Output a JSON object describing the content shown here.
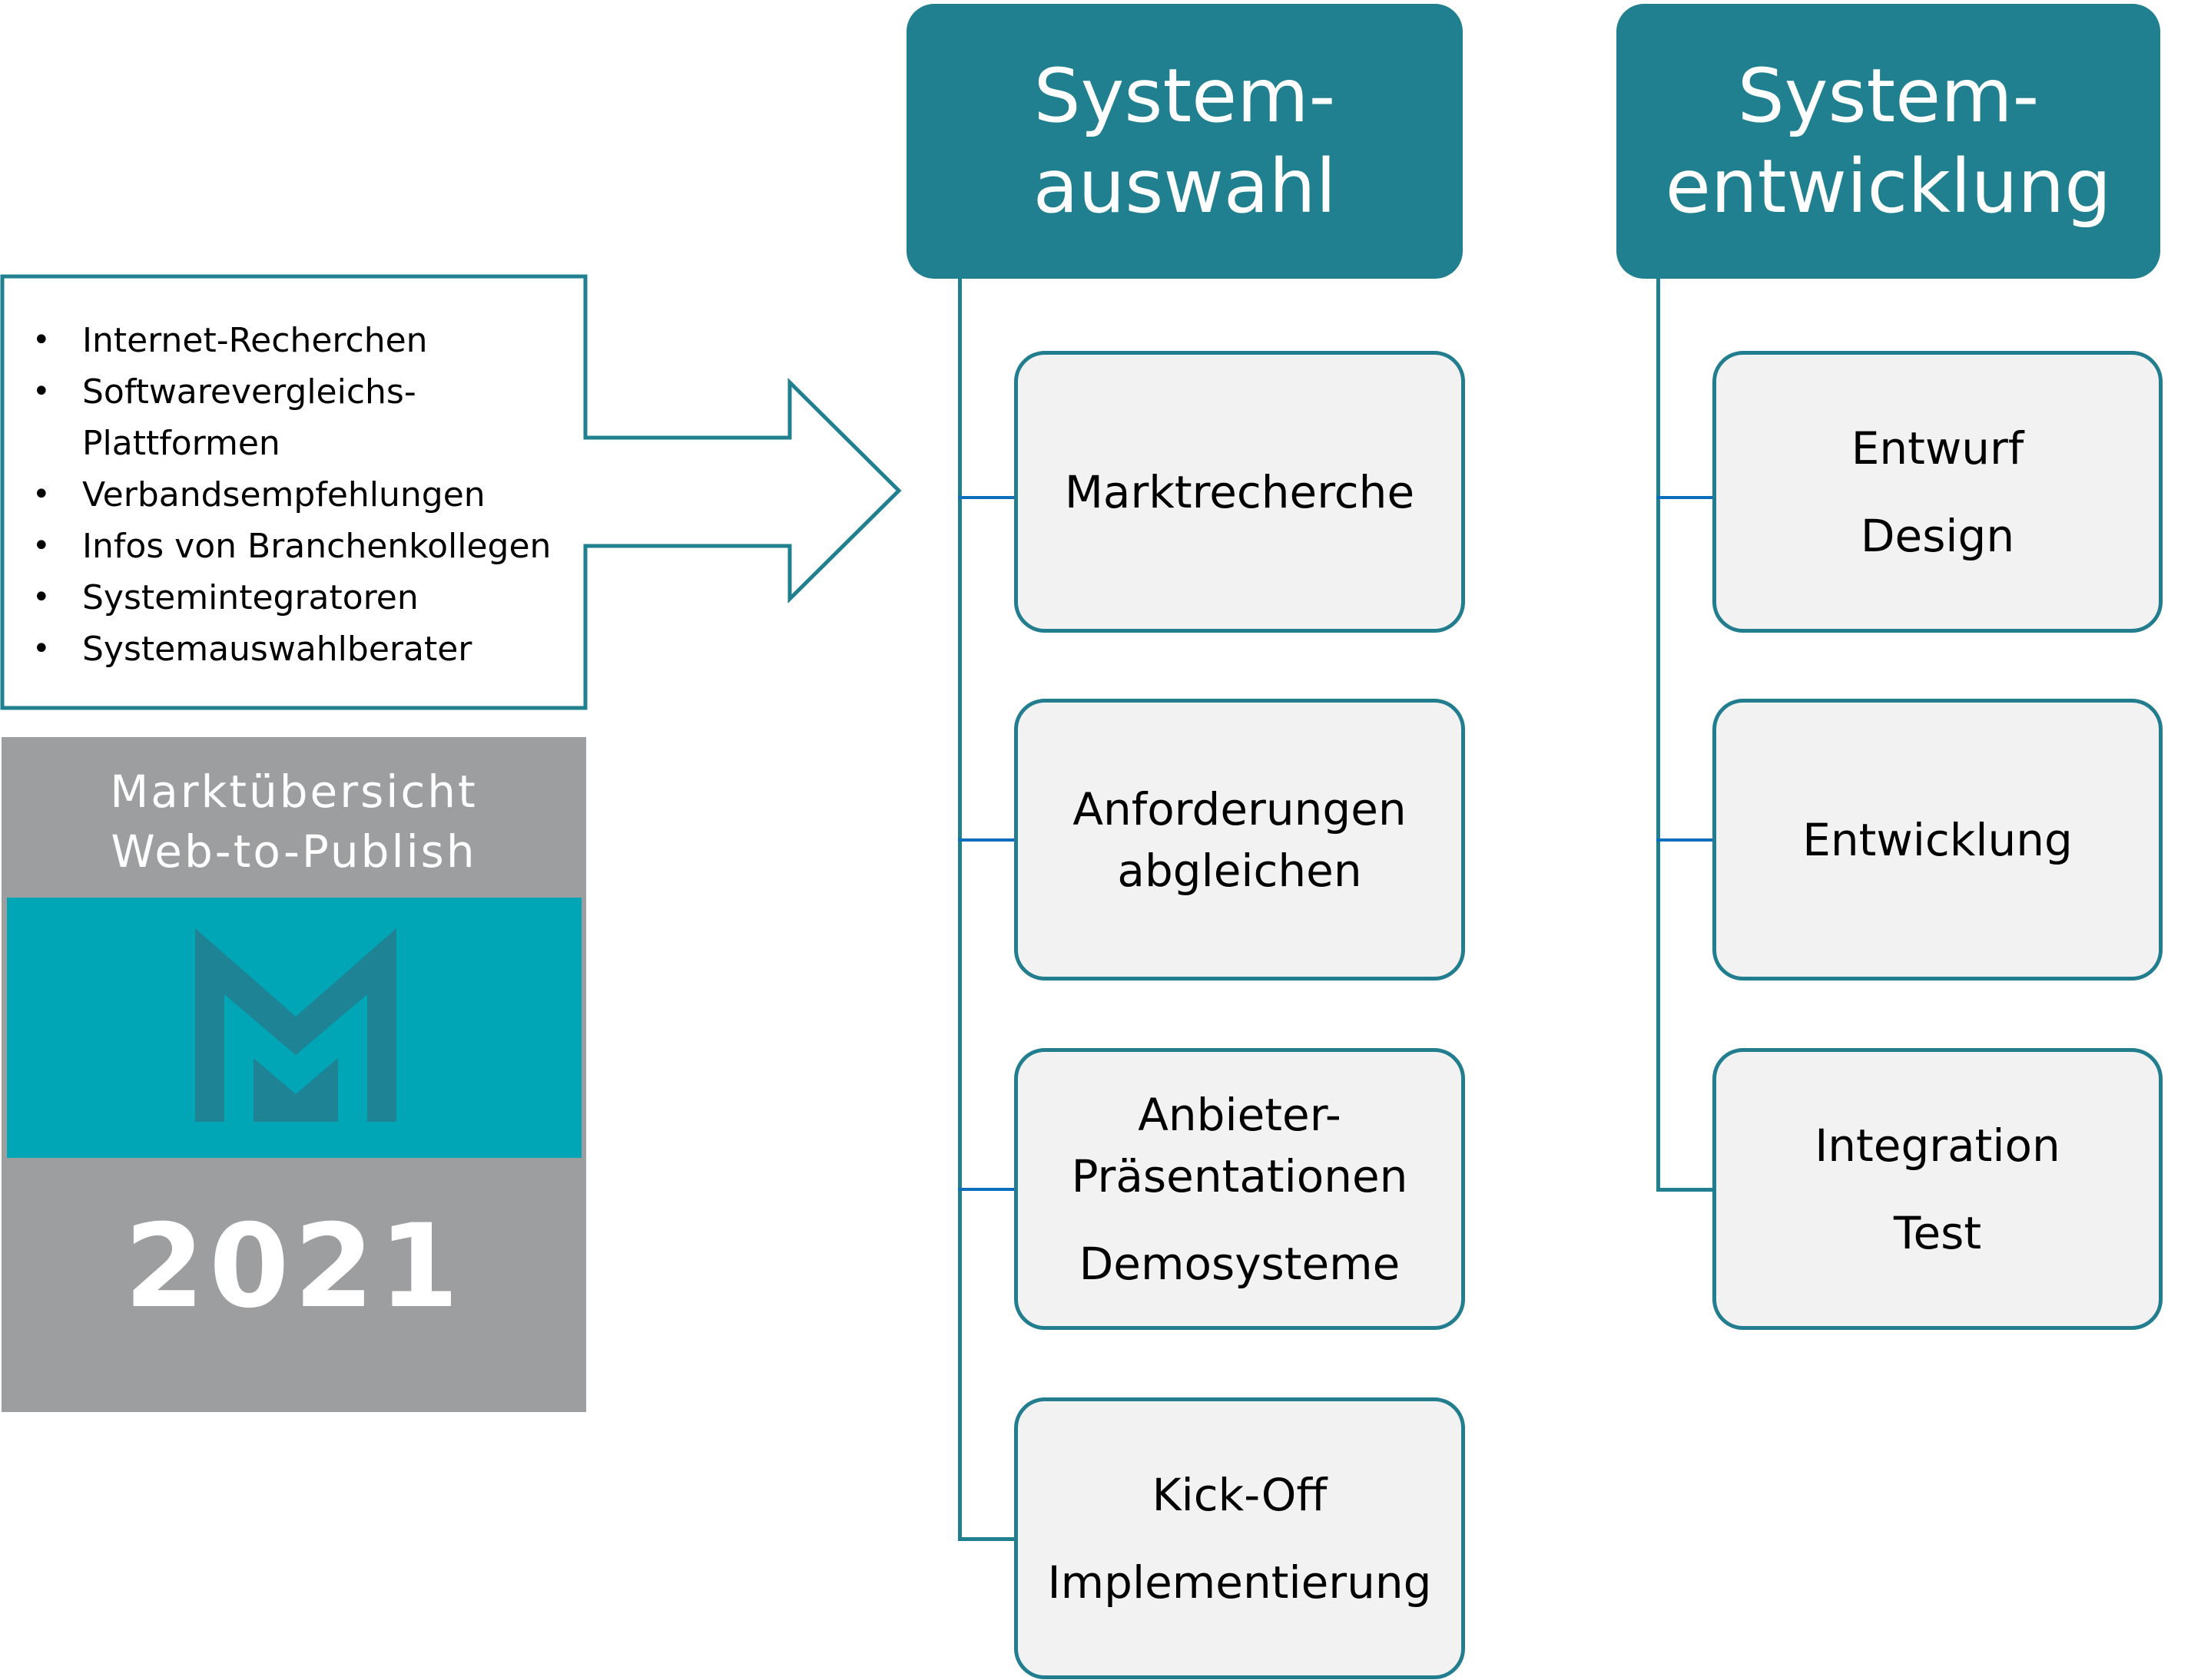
{
  "colors": {
    "header_fill": "#20808f",
    "node_border": "#227e8e",
    "node_fill": "#f2f2f2",
    "stub_line": "#0b6fbe",
    "badge_gray": "#9d9ea0",
    "badge_band": "#00a5b6",
    "logo_mark": "#1e8394"
  },
  "sources": {
    "items": [
      {
        "lines": [
          "Internet-Recherchen"
        ]
      },
      {
        "lines": [
          "Softwarevergleichs-",
          "Plattformen"
        ]
      },
      {
        "lines": [
          "Verbandsempfehlungen"
        ]
      },
      {
        "lines": [
          "Infos von Branchenkollegen"
        ]
      },
      {
        "lines": [
          "Systemintegratoren"
        ]
      },
      {
        "lines": [
          "Systemauswahlberater"
        ]
      }
    ],
    "bullet": "•"
  },
  "badge": {
    "title_lines": [
      "Marktübersicht",
      "Web-to-Publish"
    ],
    "logo_icon": "m-logo-icon",
    "year": "2021"
  },
  "columns": [
    {
      "header_lines": [
        "System-",
        "auswahl"
      ],
      "nodes": [
        {
          "groups": [
            [
              "Marktrecherche"
            ]
          ]
        },
        {
          "groups": [
            [
              "Anforderungen",
              "abgleichen"
            ]
          ]
        },
        {
          "groups": [
            [
              "Anbieter-",
              "Präsentationen"
            ],
            [
              "Demosysteme"
            ]
          ]
        },
        {
          "groups": [
            [
              "Kick-Off"
            ],
            [
              "Implementierung"
            ]
          ]
        }
      ]
    },
    {
      "header_lines": [
        "System-",
        "entwicklung"
      ],
      "nodes": [
        {
          "groups": [
            [
              "Entwurf"
            ],
            [
              "Design"
            ]
          ]
        },
        {
          "groups": [
            [
              "Entwicklung"
            ]
          ]
        },
        {
          "groups": [
            [
              "Integration"
            ],
            [
              "Test"
            ]
          ]
        }
      ]
    }
  ]
}
